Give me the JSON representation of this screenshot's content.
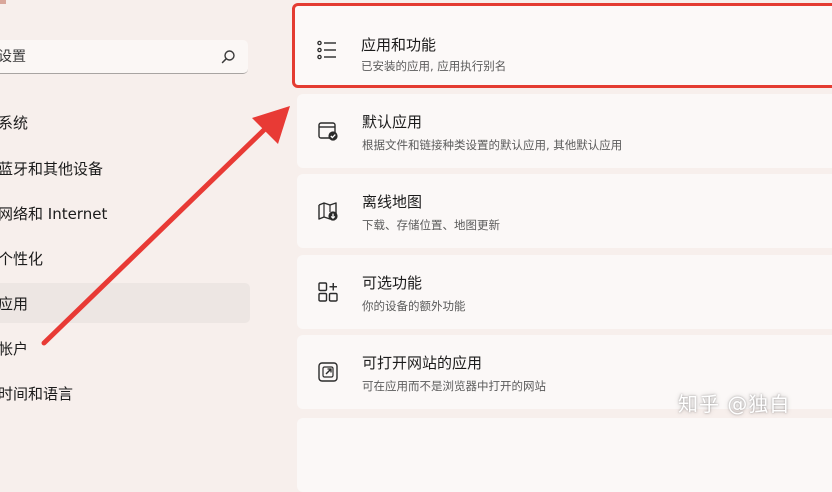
{
  "search": {
    "placeholder": "设置"
  },
  "sidebar": {
    "items": [
      {
        "label": "系统"
      },
      {
        "label": "蓝牙和其他设备"
      },
      {
        "label": "网络和 Internet"
      },
      {
        "label": "个性化"
      },
      {
        "label": "应用",
        "selected": true
      },
      {
        "label": "帐户"
      },
      {
        "label": "时间和语言"
      }
    ]
  },
  "cards": [
    {
      "title": "应用和功能",
      "desc": "已安装的应用, 应用执行别名",
      "icon": "list-icon",
      "highlighted": true
    },
    {
      "title": "默认应用",
      "desc": "根据文件和链接种类设置的默认应用, 其他默认应用",
      "icon": "default-apps-icon"
    },
    {
      "title": "离线地图",
      "desc": "下载、存储位置、地图更新",
      "icon": "offline-map-icon"
    },
    {
      "title": "可选功能",
      "desc": "你的设备的额外功能",
      "icon": "optional-features-icon"
    },
    {
      "title": "可打开网站的应用",
      "desc": "可在应用而不是浏览器中打开的网站",
      "icon": "open-website-icon"
    }
  ],
  "watermark": "知乎 @独白",
  "colors": {
    "highlight_border": "#e43c32",
    "arrow": "#e83a35",
    "background": "#f7efec",
    "card": "#fbf8f7",
    "selected_nav": "#ede6e3"
  }
}
